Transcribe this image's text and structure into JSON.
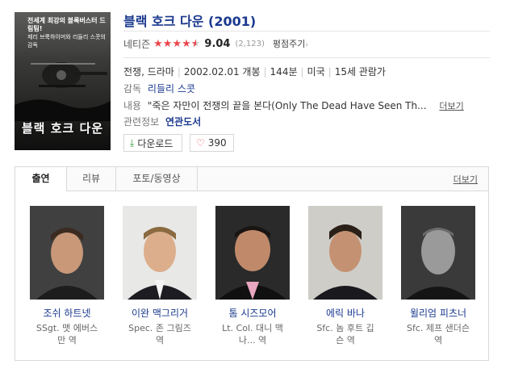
{
  "poster": {
    "tagline_1": "전세계 최강의 블록버스터 드림팀!",
    "tagline_2": "제리 브룩하이머와 리들리 스콧의 감독",
    "title": "블랙 호크 다운"
  },
  "movie": {
    "title": "블랙 호크 다운 (2001)",
    "rating_label": "네티즌",
    "stars_filled": 4.5,
    "stars_total": 5,
    "score": "9.04",
    "rating_count": "(2,123)",
    "rate_link": "평점주기",
    "genre": "전쟁, 드라마",
    "release": "2002.02.01 개봉",
    "runtime": "144분",
    "country": "미국",
    "age": "15세 관람가",
    "director_label": "감독",
    "director": "리들리 스콧",
    "content_label": "내용",
    "content": "\"죽은 자만이 전쟁의 끝을 본다(Only The Dead Have Seen Th...",
    "content_more": "더보기",
    "related_label": "관련정보",
    "related": "연관도서",
    "download_label": "다운로드",
    "like_count": "390"
  },
  "tabs": {
    "items": [
      "출연",
      "리뷰",
      "포토/동영상"
    ],
    "more": "더보기"
  },
  "cast": [
    {
      "name": "조쉬 하트넷",
      "role_1": "SSgt. 맷 에버스",
      "role_2": "만 역"
    },
    {
      "name": "이완 맥그리거",
      "role_1": "Spec. 존 그림즈",
      "role_2": "역"
    },
    {
      "name": "톰 시즈모어",
      "role_1": "Lt. Col. 대니 맥",
      "role_2": "나... 역"
    },
    {
      "name": "에릭 바나",
      "role_1": "Sfc. 놈 후트 깁",
      "role_2": "슨 역"
    },
    {
      "name": "윌리엄 피츠너",
      "role_1": "Sfc. 제프 샌더슨",
      "role_2": "역"
    }
  ],
  "colors": {
    "link": "#1b3a8f",
    "star": "#e8474d",
    "download_icon": "#3aa041"
  }
}
